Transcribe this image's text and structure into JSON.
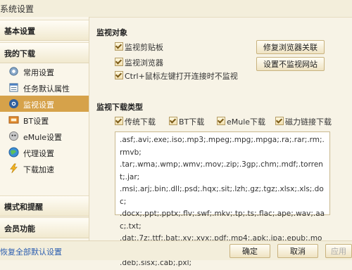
{
  "window": {
    "title": "系统设置"
  },
  "sidebar": {
    "sections": [
      {
        "label": "基本设置"
      },
      {
        "label": "我的下载"
      },
      {
        "label": "模式和提醒"
      },
      {
        "label": "会员功能"
      }
    ],
    "items": [
      {
        "label": "常用设置",
        "icon": "gear-icon"
      },
      {
        "label": "任务默认属性",
        "icon": "properties-icon"
      },
      {
        "label": "监视设置",
        "icon": "monitor-eye-icon",
        "active": true
      },
      {
        "label": "BT设置",
        "icon": "bt-icon"
      },
      {
        "label": "eMule设置",
        "icon": "emule-icon"
      },
      {
        "label": "代理设置",
        "icon": "globe-icon"
      },
      {
        "label": "下载加速",
        "icon": "lightning-icon"
      }
    ]
  },
  "monitor_object": {
    "heading": "监视对象",
    "options": [
      {
        "label": "监视剪贴板",
        "checked": true
      },
      {
        "label": "监视浏览器",
        "checked": true
      },
      {
        "label": "Ctrl+鼠标左键打开连接时不监视",
        "checked": true
      }
    ],
    "buttons": {
      "repair_browser": "修复浏览器关联",
      "set_site": "设置不监视网站"
    }
  },
  "monitor_types": {
    "heading": "监视下载类型",
    "options": [
      {
        "label": "传统下载",
        "checked": true
      },
      {
        "label": "BT下载",
        "checked": true
      },
      {
        "label": "eMule下载",
        "checked": true
      },
      {
        "label": "磁力链接下载",
        "checked": true
      }
    ],
    "extensions": ".asf;.avi;.exe;.iso;.mp3;.mpeg;.mpg;.mpga;.ra;.rar;.rm;.rmvb;\n.tar;.wma;.wmp;.wmv;.mov;.zip;.3gp;.chm;.mdf;.torrent;.jar;\n.msi;.arj;.bin;.dll;.psd;.hqx;.sit;.lzh;.gz;.tgz;.xlsx;.xls;.doc;\n.docx;.ppt;.pptx;.flv;.swf;.mkv;.tp;.ts;.flac;.ape;.wav;.aac;.txt;\n.dat;.7z;.ttf;.bat;.xv;.xvx;.pdf;.mp4;.apk;.ipa;.epub;.mobi;\n.deb;.sisx;.cab;.pxl;"
  },
  "footer": {
    "restore_link": "恢复全部默认设置",
    "ok": "确定",
    "cancel": "取消",
    "apply": "应用"
  },
  "colors": {
    "active_item": "#d6a24a",
    "link": "#2a5db0"
  }
}
